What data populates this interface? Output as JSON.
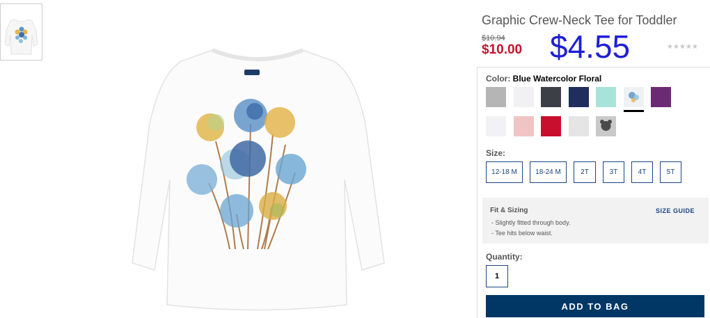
{
  "product": {
    "title": "Graphic Crew-Neck Tee for Toddler",
    "original_price": "$10.94",
    "sale_price": "$10.00",
    "promo_price": "$4.55",
    "rating_stars": "★★★★★"
  },
  "color": {
    "label": "Color:",
    "selected": "Blue Watercolor Floral",
    "swatches": [
      {
        "name": "heather gray",
        "hex": "#b5b5b5"
      },
      {
        "name": "white",
        "hex": "#f1f1f3"
      },
      {
        "name": "charcoal",
        "hex": "#3d3f47"
      },
      {
        "name": "navy",
        "hex": "#1f2e5c"
      },
      {
        "name": "mint",
        "hex": "#a8e3d9"
      },
      {
        "name": "blue watercolor floral",
        "hex": "#e8eef2"
      },
      {
        "name": "purple",
        "hex": "#6b2a73"
      },
      {
        "name": "white 2",
        "hex": "#f2f2f6"
      },
      {
        "name": "light pink",
        "hex": "#f0c4c4"
      },
      {
        "name": "red",
        "hex": "#c8102e"
      },
      {
        "name": "light gray",
        "hex": "#e5e5e5"
      },
      {
        "name": "gray graphic",
        "hex": "#9a9a9a"
      }
    ]
  },
  "size": {
    "label": "Size:",
    "options": [
      "12-18 M",
      "18-24 M",
      "2T",
      "3T",
      "4T",
      "5T"
    ]
  },
  "fit": {
    "title": "Fit & Sizing",
    "lines": [
      "- Slightly fitted through body.",
      "- Tee hits below waist."
    ],
    "size_guide": "SIZE GUIDE"
  },
  "quantity": {
    "label": "Quantity:",
    "value": "1"
  },
  "add_to_bag": "ADD TO BAG"
}
